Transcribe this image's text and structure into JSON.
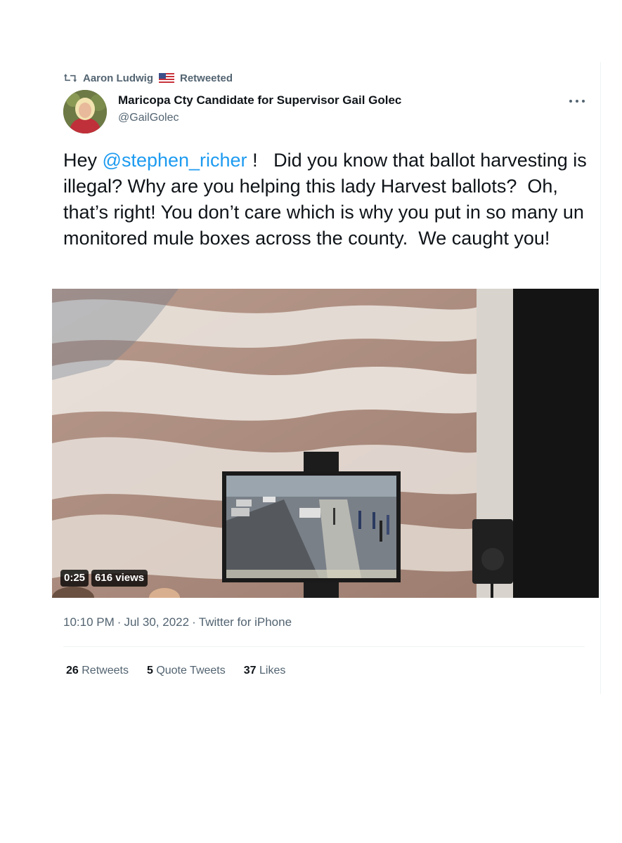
{
  "retweet": {
    "icon": "retweet-icon",
    "name": "Aaron Ludwig",
    "flag": "us-flag-icon",
    "suffix": "Retweeted"
  },
  "author": {
    "name": "Maricopa Cty Candidate for Supervisor Gail Golec",
    "handle": "@GailGolec"
  },
  "more_icon": "more-horizontal-icon",
  "tweet": {
    "prefix": "Hey ",
    "mention": "@stephen_richer",
    "body": " !   Did you know that ballot harvesting is illegal? Why are you helping this lady Harvest ballots?  Oh, that’s right! You don’t care which is why you put in so many un monitored mule boxes across the county.  We caught you!"
  },
  "video": {
    "duration": "0:25",
    "views": "616 views"
  },
  "meta": {
    "time": "10:10 PM",
    "separator": "·",
    "date": "Jul 30, 2022",
    "source": "Twitter for iPhone"
  },
  "stats": {
    "retweets_count": "26",
    "retweets_label": "Retweets",
    "quotes_count": "5",
    "quotes_label": "Quote Tweets",
    "likes_count": "37",
    "likes_label": "Likes"
  },
  "colors": {
    "accent": "#1d9bf0",
    "secondary_text": "#536471",
    "primary_text": "#0f1419"
  }
}
